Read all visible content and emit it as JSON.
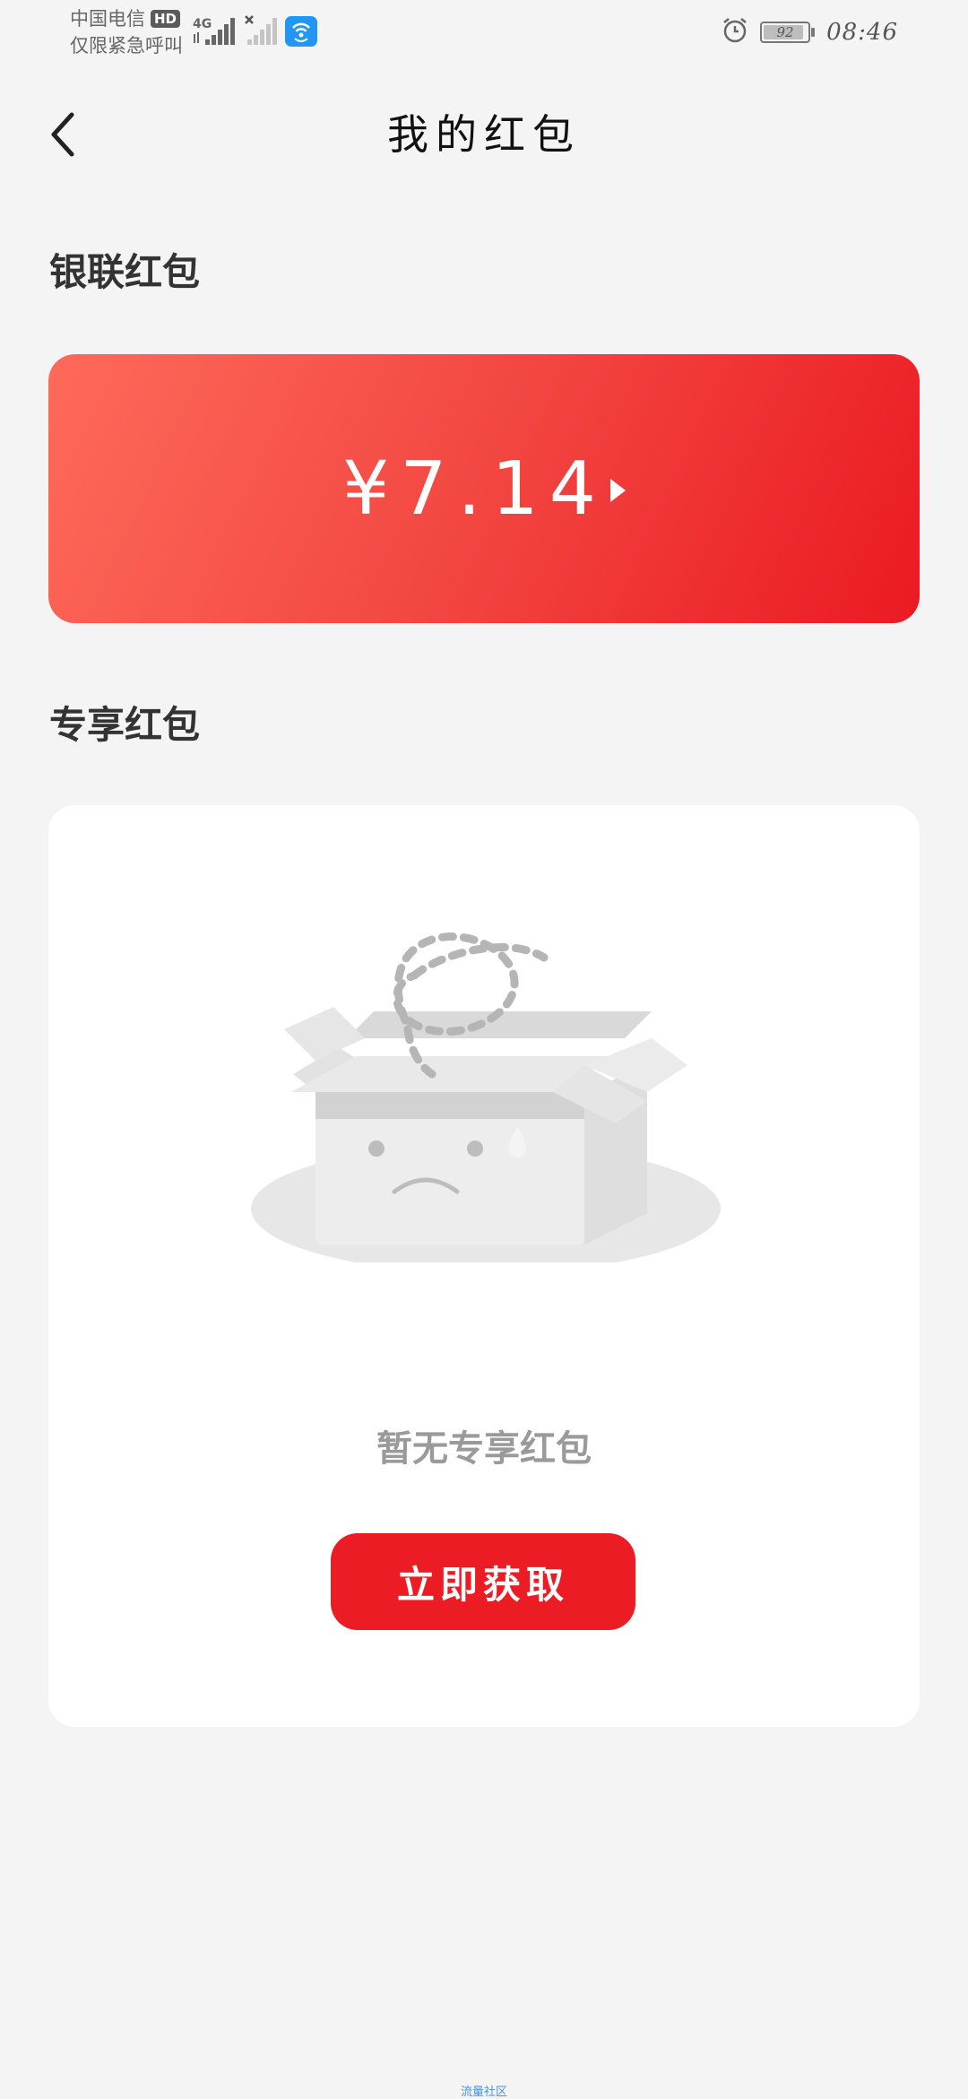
{
  "status_bar": {
    "carrier_line1": "中国电信",
    "carrier_badge": "HD",
    "carrier_line2": "仅限紧急呼叫",
    "network_type": "4G",
    "battery_level": "92",
    "time": "08:46",
    "icons": [
      "signal-4g-icon",
      "signal-x-icon",
      "wifi-calling-icon",
      "alarm-icon",
      "battery-icon"
    ]
  },
  "nav": {
    "title": "我的红包",
    "back_icon": "chevron-left-icon"
  },
  "unionpay_section": {
    "title": "银联红包",
    "amount": "¥7.14"
  },
  "exclusive_section": {
    "title": "专享红包",
    "empty_text": "暂无专享红包",
    "action_label": "立即获取"
  },
  "watermark": "流量社区",
  "colors": {
    "accent": "#eb1c24",
    "card_gradient_start": "#ff6a5a",
    "card_gradient_end": "#eb1a22",
    "background": "#f4f4f4"
  }
}
